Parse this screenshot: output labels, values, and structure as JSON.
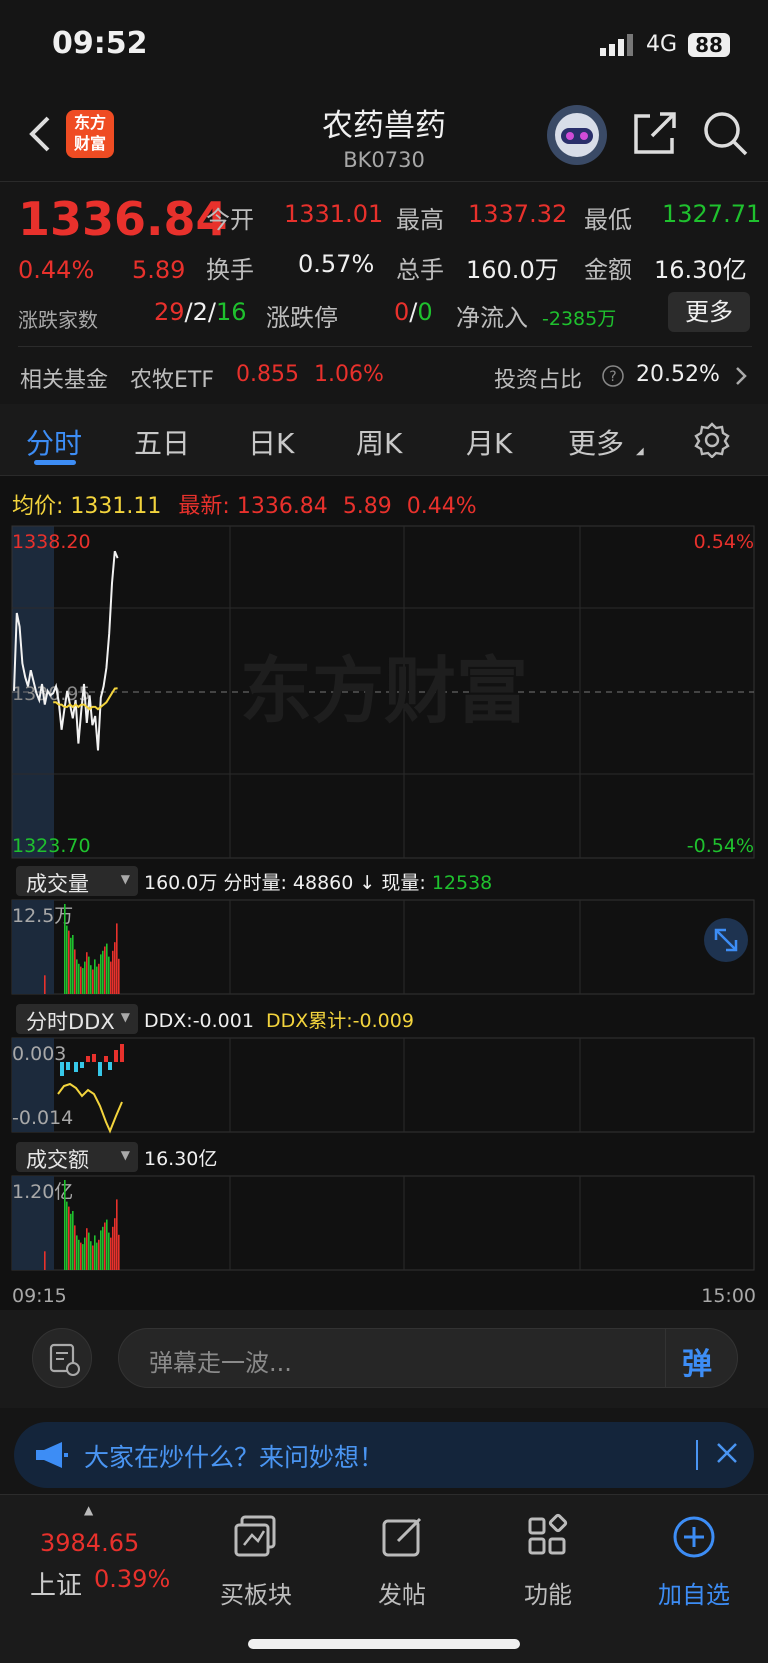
{
  "status": {
    "time": "09:52",
    "network": "4G",
    "battery": "88"
  },
  "header": {
    "title": "农药兽药",
    "code": "BK0730",
    "logo_text_1": "东方",
    "logo_text_2": "财富"
  },
  "quote": {
    "price": "1336.84",
    "change_pct": "0.44%",
    "change": "5.89",
    "open_label": "今开",
    "open": "1331.01",
    "high_label": "最高",
    "high": "1337.32",
    "low_label": "最低",
    "low": "1327.71",
    "turnover_label": "换手",
    "turnover": "0.57%",
    "volume_label": "总手",
    "volume": "160.0万",
    "amount_label": "金额",
    "amount": "16.30亿",
    "breadth_label": "涨跌家数",
    "up": "29",
    "flat": "2",
    "down": "16",
    "limit_label": "涨跌停",
    "limit_up": "0",
    "limit_down": "0",
    "netflow_label": "净流入",
    "netflow": "-2385万",
    "more_label": "更多",
    "fund_label": "相关基金",
    "fund_name": "农牧ETF",
    "fund_price": "0.855",
    "fund_pct": "1.06%",
    "ratio_label": "投资占比",
    "ratio": "20.52%",
    "sep": "/"
  },
  "tabs": [
    "分时",
    "五日",
    "日K",
    "周K",
    "月K",
    "更多"
  ],
  "chart_data": [
    {
      "type": "line",
      "title": "分时",
      "avg_label": "均价:",
      "avg": "1331.11",
      "latest_label": "最新:",
      "latest": "1336.84",
      "latest_change": "5.89",
      "latest_pct": "0.44%",
      "y_top": "1338.20",
      "y_bottom": "1323.70",
      "y_mid": "1330.95",
      "pct_top": "0.54%",
      "pct_bottom": "-0.54%",
      "ylim": [
        1323.7,
        1338.2
      ],
      "x_start": "09:15",
      "x_end": "15:00",
      "watermark": "东方财富",
      "series": [
        {
          "values": [
            1331.0,
            1334.4,
            1333.8,
            1332.2,
            1331.6,
            1331.2,
            1331.9,
            1331.4,
            1330.9,
            1330.6,
            1331.3,
            1330.4,
            1331.0,
            1330.8,
            1330.9,
            1331.2,
            1330.5,
            1329.3,
            1330.2,
            1331.0,
            1330.4,
            1329.8,
            1330.6,
            1328.7,
            1330.1,
            1331.3,
            1329.6,
            1330.8,
            1329.5,
            1329.9,
            1328.4,
            1330.7,
            1331.2,
            1332.0,
            1333.5,
            1335.7,
            1337.1,
            1336.8
          ]
        },
        {
          "values": [
            1330.9,
            1330.9,
            1330.8,
            1330.7,
            1330.6,
            1330.6,
            1330.7,
            1330.6,
            1330.6,
            1330.5,
            1330.5,
            1330.5,
            1330.4,
            1330.4,
            1330.5,
            1330.5,
            1330.4,
            1330.4,
            1330.3,
            1330.3,
            1330.4,
            1330.3,
            1330.4,
            1330.3,
            1330.4,
            1330.4,
            1330.3,
            1330.2,
            1330.3,
            1330.3,
            1330.2,
            1330.3,
            1330.4,
            1330.5,
            1330.7,
            1330.9,
            1331.1,
            1331.11
          ]
        }
      ]
    },
    {
      "type": "bar",
      "title": "成交量",
      "total": "160.0万",
      "period_label": "分时量:",
      "period": "48860",
      "now_label": "现量:",
      "now": "12538",
      "y_max_label": "12.5万",
      "ylim": [
        0,
        125000
      ],
      "values": [
        26000,
        0,
        0,
        0,
        0,
        0,
        0,
        0,
        0,
        0,
        125000,
        95000,
        88000,
        78000,
        82000,
        62000,
        48000,
        42000,
        38000,
        36000,
        45000,
        58000,
        52000,
        40000,
        34000,
        48000,
        38000,
        42000,
        55000,
        60000,
        66000,
        70000,
        52000,
        45000,
        60000,
        72000,
        98000,
        48860
      ]
    },
    {
      "type": "bar",
      "title": "分时DDX",
      "ddx_label": "DDX:",
      "ddx": "-0.001",
      "cum_label": "DDX累计:",
      "cum": "-0.009",
      "y_top": "0.003",
      "y_bottom": "-0.014",
      "ylim": [
        -0.014,
        0.003
      ]
    },
    {
      "type": "bar",
      "title": "成交额",
      "total": "16.30亿",
      "y_max_label": "1.20亿",
      "ylim": [
        0,
        1.2
      ]
    }
  ],
  "comment": {
    "placeholder": "弹幕走一波...",
    "send_label": "弹"
  },
  "banner": {
    "text": "大家在炒什么？来问妙想！"
  },
  "nav": {
    "index_value": "3984.65",
    "index_name": "上证",
    "index_pct": "0.39%",
    "items": [
      "买板块",
      "发帖",
      "功能",
      "加自选"
    ]
  },
  "colors": {
    "up": "#e8312c",
    "down": "#1fc12e",
    "accent": "#3d8df5",
    "avg": "#f3d43d"
  }
}
